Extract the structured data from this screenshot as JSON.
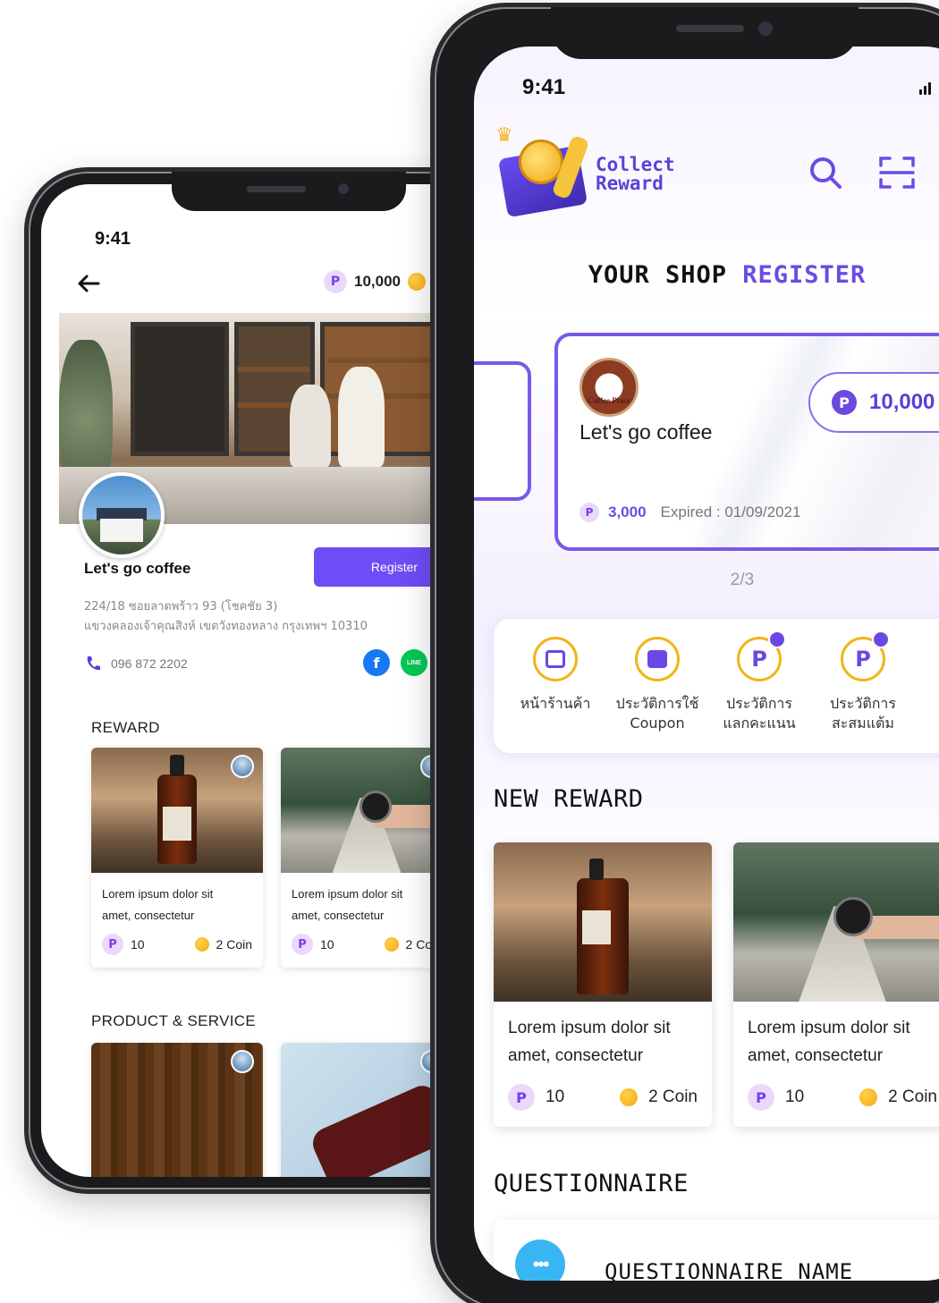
{
  "back_phone": {
    "status_time": "9:41",
    "points": "10,000",
    "shop": {
      "name": "Let's go coffee",
      "register_label": "Register",
      "address_line1": "224/18 ซอยลาดพร้าว 93 (โชคชัย 3)",
      "address_line2": "แขวงคลองเจ้าคุณสิงห์ เขตวังทองหลาง กรุงเทพฯ 10310",
      "phone": "096 872 2202"
    },
    "sections": {
      "reward": "REWARD",
      "product_service": "PRODUCT & SERVICE"
    },
    "reward_cards": [
      {
        "title_line1": "Lorem ipsum dolor sit",
        "title_line2": "amet, consectetur",
        "points": "10",
        "coin": "2 Coin"
      },
      {
        "title_line1": "Lorem ipsum dolor sit",
        "title_line2": "amet, consectetur",
        "points": "10",
        "coin": "2 Coin"
      }
    ]
  },
  "front_phone": {
    "status_time": "9:41",
    "logo": {
      "line1": "Collect",
      "line2": "Reward"
    },
    "heading": {
      "part1": "YOUR SHOP",
      "part2": "REGISTER"
    },
    "shop_card": {
      "name": "Let's go coffee",
      "logo_text": "Coffee Place",
      "points_balance": "10,000",
      "points": "3,000",
      "expired": "Expired : 01/09/2021"
    },
    "pager": "2/3",
    "menu": [
      {
        "line1": "หน้าร้านค้า",
        "line2": ""
      },
      {
        "line1": "ประวัติการใช้",
        "line2": "Coupon"
      },
      {
        "line1": "ประวัติการ",
        "line2": "แลกคะแนน"
      },
      {
        "line1": "ประวัติการ",
        "line2": "สะสมแต้ม"
      }
    ],
    "sections": {
      "new_reward": "NEW REWARD",
      "questionnaire": "QUESTIONNAIRE"
    },
    "reward_cards": [
      {
        "title_line1": "Lorem ipsum dolor sit",
        "title_line2": "amet, consectetur",
        "points": "10",
        "coin": "2 Coin"
      },
      {
        "title_line1": "Lorem ipsum dolor sit",
        "title_line2": "amet, consectetur",
        "points": "10",
        "coin": "2 Coin"
      }
    ],
    "questionnaire_name": "QUESTIONNAIRE NAME"
  },
  "icons": {
    "p_badge": "P",
    "facebook": "f",
    "line": "LINE",
    "chat": "•••"
  },
  "colors": {
    "brand_purple": "#6e4df6",
    "accent_gold": "#f3b41a",
    "frame": "#1b1b1d"
  }
}
